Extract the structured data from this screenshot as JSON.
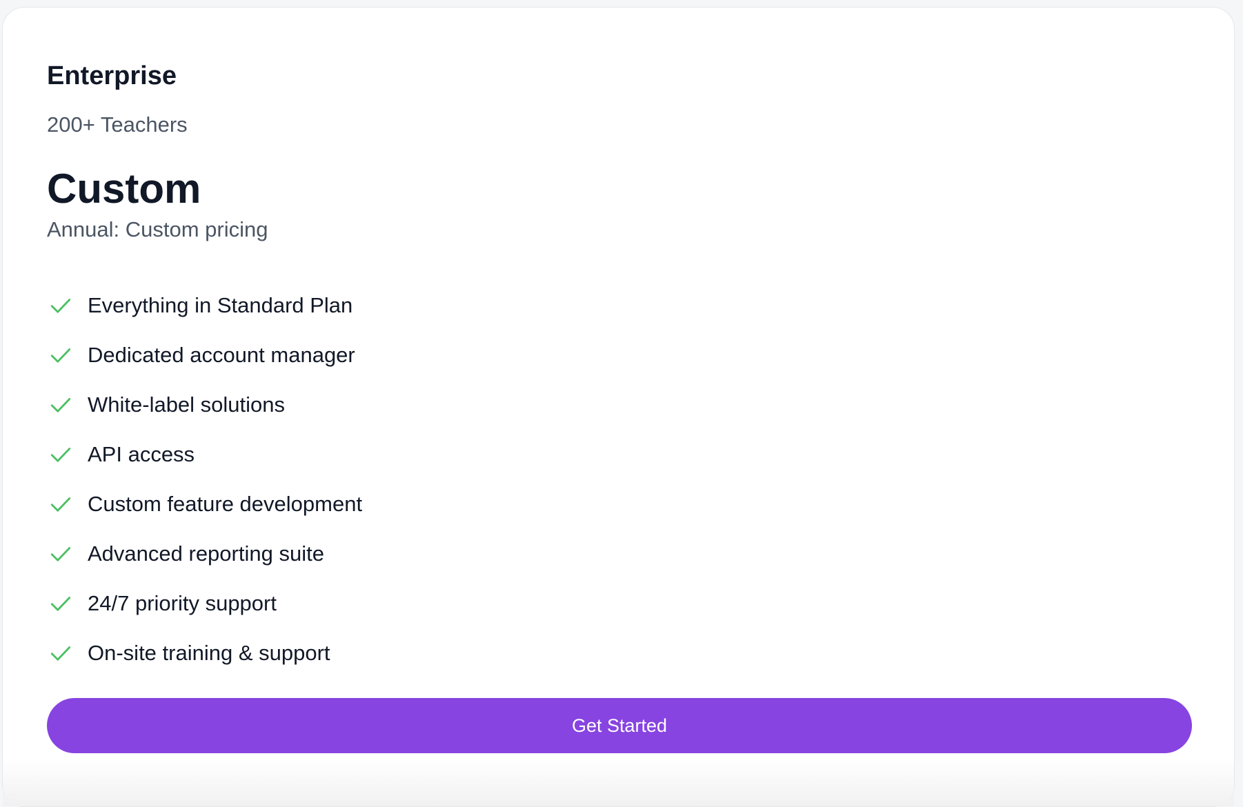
{
  "plan": {
    "name": "Enterprise",
    "audience": "200+ Teachers",
    "price": "Custom",
    "billing": "Annual: Custom pricing",
    "features": [
      "Everything in Standard Plan",
      "Dedicated account manager",
      "White-label solutions",
      "API access",
      "Custom feature development",
      "Advanced reporting suite",
      "24/7 priority support",
      "On-site training & support"
    ],
    "cta_label": "Get Started"
  },
  "colors": {
    "accent": "#8744e0",
    "check": "#4cc063"
  }
}
